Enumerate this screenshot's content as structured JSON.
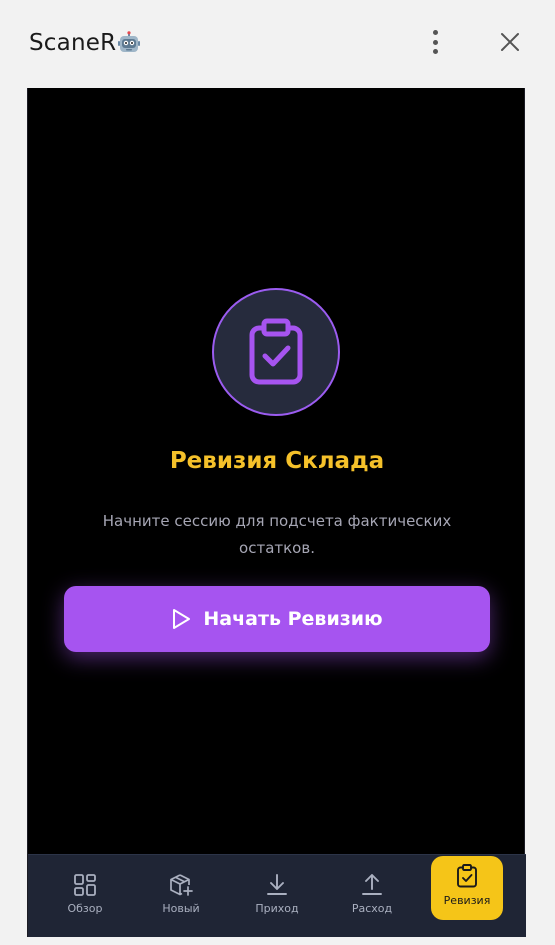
{
  "titlebar": {
    "app_name": "ScaneR"
  },
  "hero": {
    "title": "Ревизия Склада",
    "description": "Начните сессию для подсчета фактических остатков.",
    "start_button": "Начать Ревизию"
  },
  "nav": {
    "items": [
      {
        "label": "Обзор",
        "icon": "grid-icon"
      },
      {
        "label": "Новый",
        "icon": "box-plus-icon"
      },
      {
        "label": "Приход",
        "icon": "download-icon"
      },
      {
        "label": "Расход",
        "icon": "upload-icon"
      },
      {
        "label": "Ревизия",
        "icon": "clipboard-check-icon",
        "active": true
      }
    ]
  },
  "colors": {
    "accent_purple": "#a654f0",
    "accent_yellow": "#f5c518",
    "title_yellow": "#f5c12a",
    "nav_bg": "#1f2535"
  }
}
